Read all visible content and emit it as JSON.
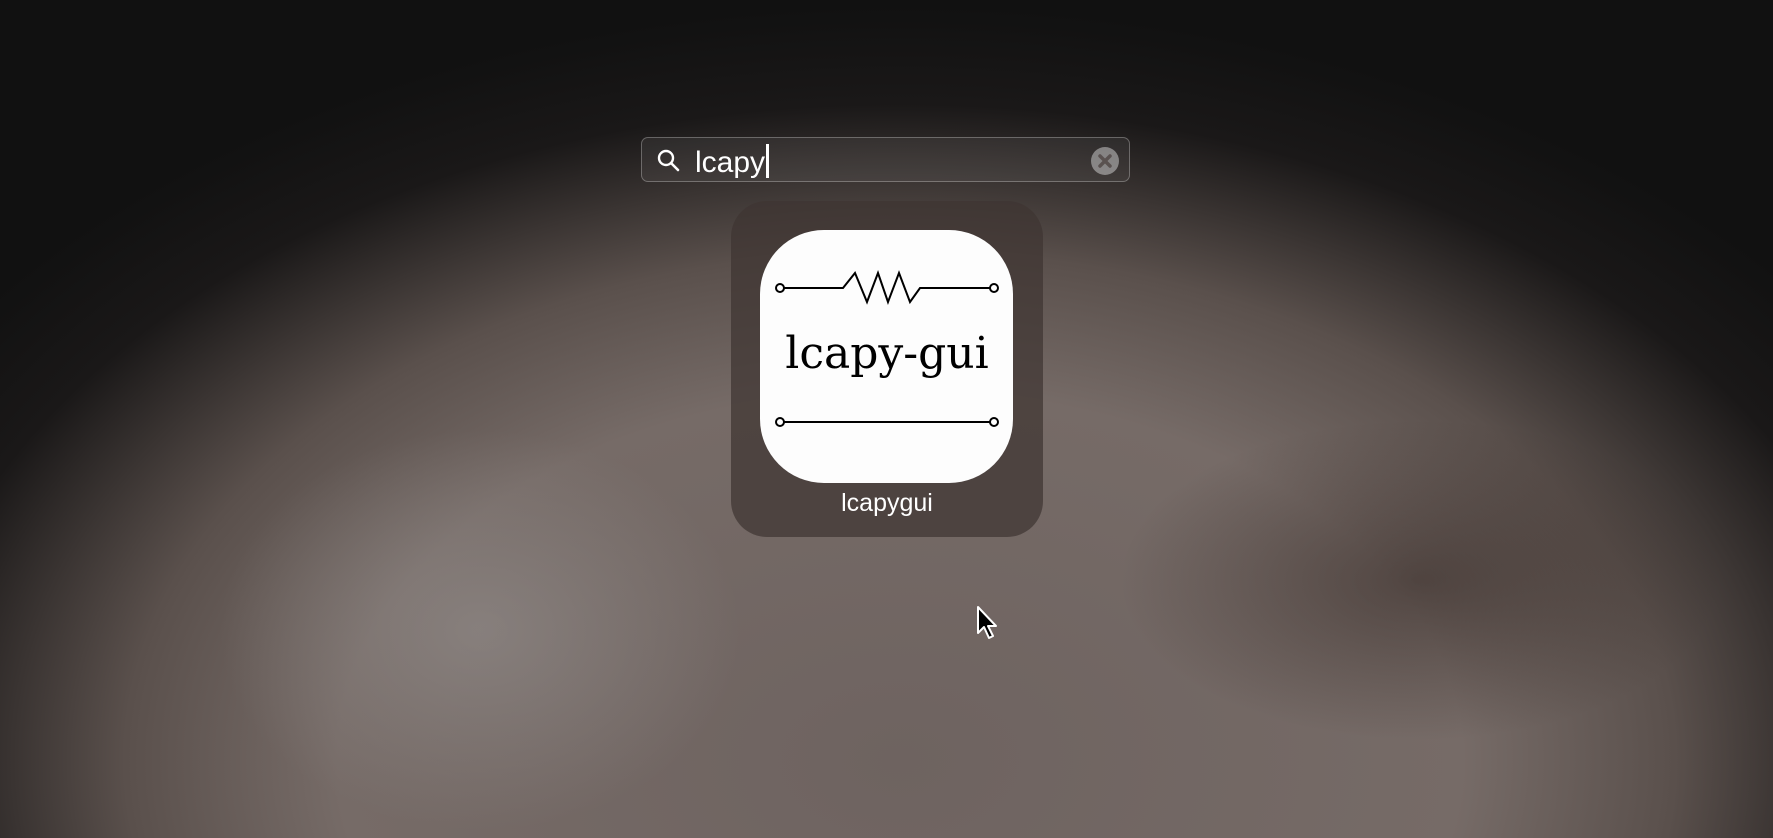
{
  "search": {
    "query": "lcapy"
  },
  "results": [
    {
      "name": "lcapygui",
      "icon_text": "lcapy-gui"
    }
  ],
  "colors": {
    "tile": "#3e3432",
    "icon_bg": "#fdfdfd"
  }
}
